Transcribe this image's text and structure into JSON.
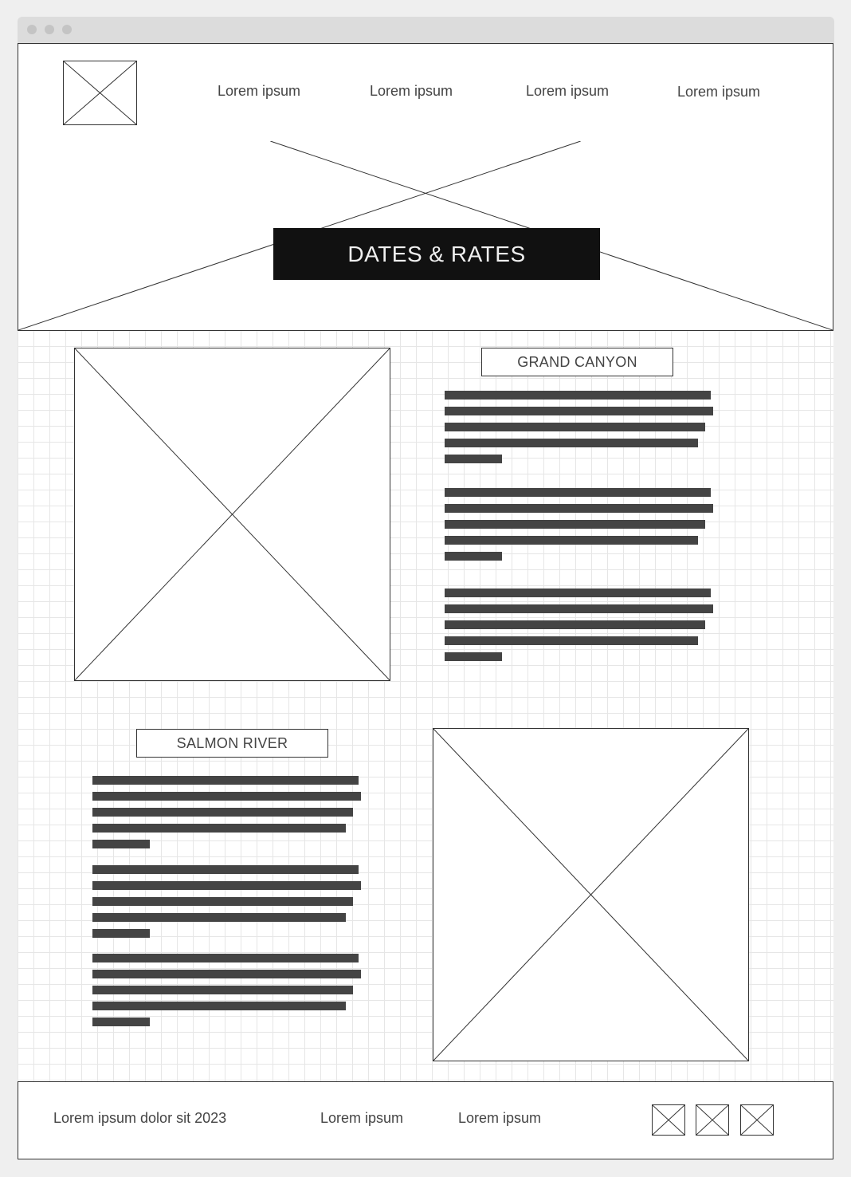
{
  "header": {
    "nav": [
      "Lorem ipsum",
      "Lorem ipsum",
      "Lorem ipsum",
      "Lorem ipsum"
    ]
  },
  "hero": {
    "title": "DATES & RATES"
  },
  "sections": [
    {
      "title": "GRAND CANYON"
    },
    {
      "title": "SALMON RIVER"
    }
  ],
  "footer": {
    "copyright": "Lorem ipsum dolor sit 2023",
    "links": [
      "Lorem ipsum",
      "Lorem ipsum"
    ]
  },
  "colors": {
    "window_chrome": "#dcdcdc",
    "outline": "#333333",
    "text": "#444444",
    "banner_bg": "#111111",
    "grid_line": "#e6e6e6"
  }
}
